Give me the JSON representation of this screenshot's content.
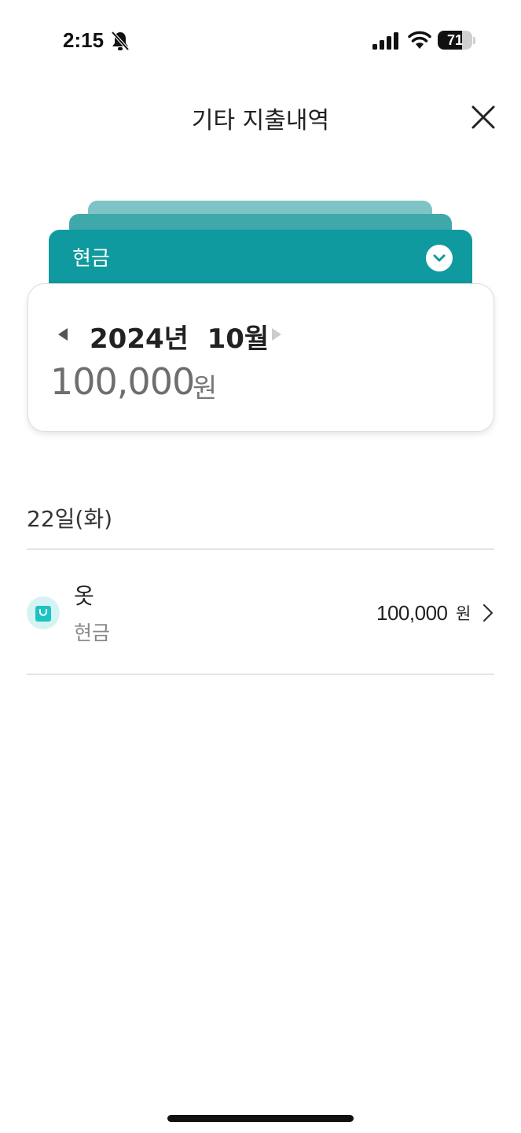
{
  "status_bar": {
    "time": "2:15",
    "battery_level": "71",
    "battery_fraction": 0.71
  },
  "header": {
    "title": "기타 지출내역",
    "close_icon": "close-icon"
  },
  "account_card": {
    "label": "현금",
    "toggle_icon": "chevron-down-icon",
    "color": "#0e9a9e"
  },
  "summary": {
    "month": "2024년  10월",
    "total_amount": "100,000",
    "total_unit": "원"
  },
  "day_group": {
    "date": "22일(화)",
    "transactions": [
      {
        "name": "옷",
        "method": "현금",
        "amount": "100,000",
        "unit": "원",
        "icon": "shopping-bag-icon"
      }
    ]
  },
  "colors": {
    "accent": "#0e9a9e",
    "icon_tint": "#1cc3c3"
  }
}
